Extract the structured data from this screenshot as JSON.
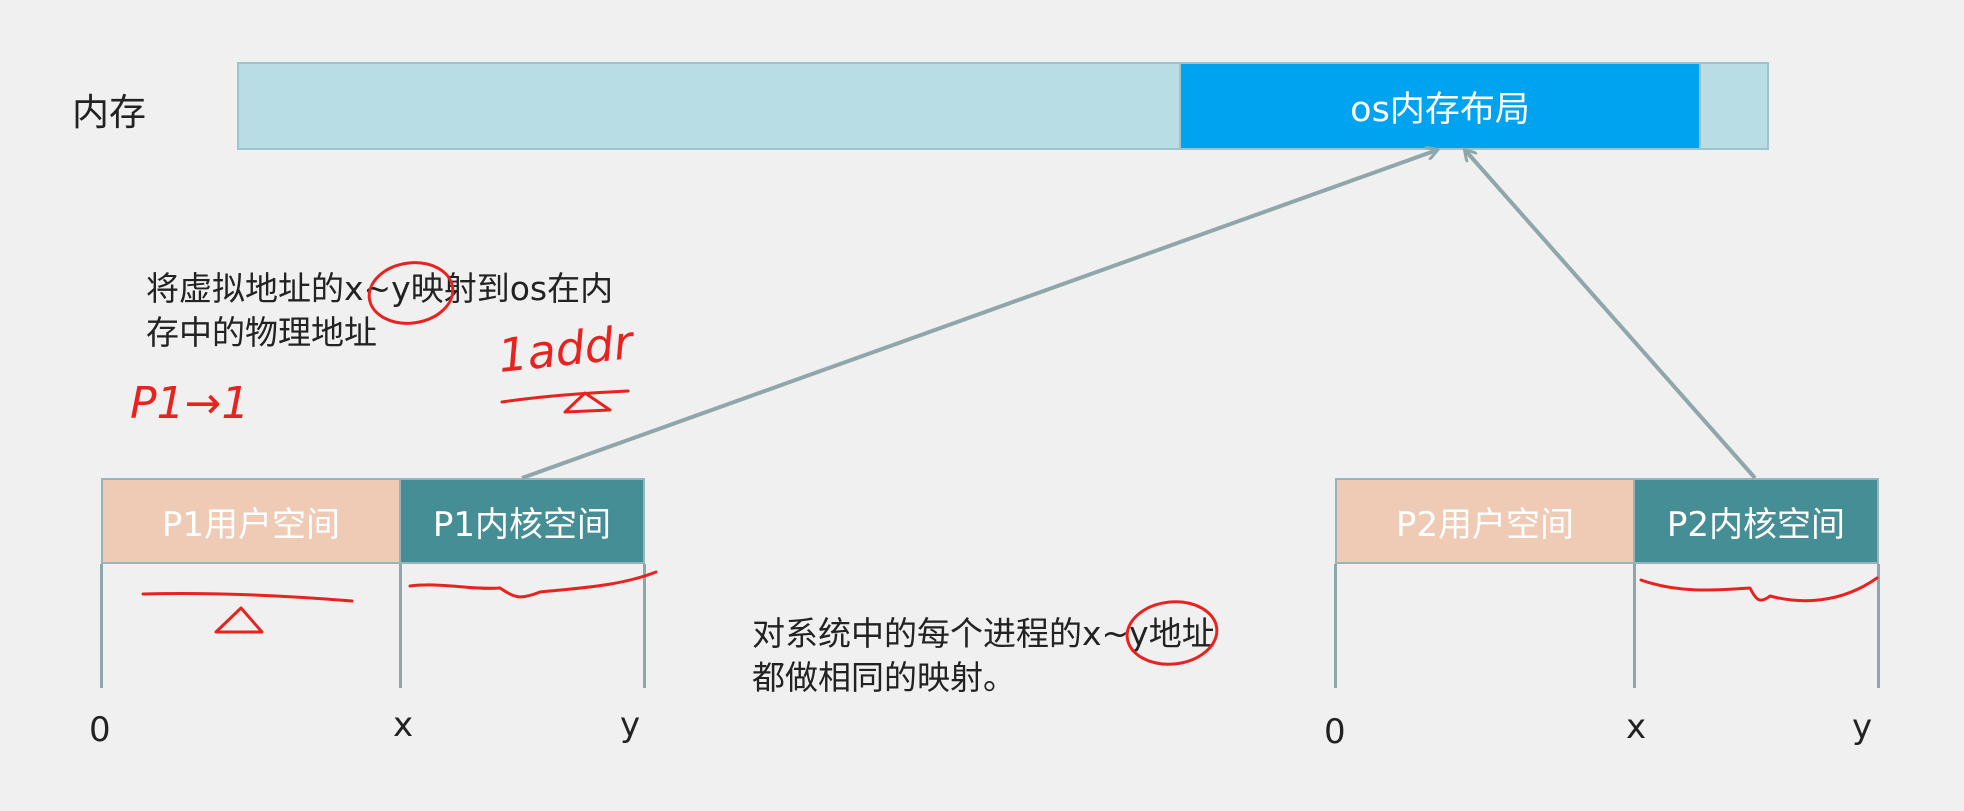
{
  "memory": {
    "label": "内存",
    "os_segment": "os内存布局"
  },
  "p1": {
    "user": "P1用户空间",
    "kernel": "P1内核空间",
    "axis": [
      "0",
      "x",
      "y"
    ]
  },
  "p2": {
    "user": "P2用户空间",
    "kernel": "P2内核空间",
    "axis": [
      "0",
      "x",
      "y"
    ]
  },
  "note_top": [
    "将虚拟地址的x~y映射到os在内",
    "存中的物理地址"
  ],
  "note_bottom": [
    "对系统中的每个进程的x~y地址",
    "都做相同的映射。"
  ],
  "handwriting": [
    "P1→1",
    "1addr"
  ],
  "colors": {
    "memory_bar": "#b9dde4",
    "os_segment": "#00a3f0",
    "user_space": "#efcbb6",
    "kernel_space": "#458e96",
    "arrow": "#8fa6aa",
    "annotation": "#e8231f"
  }
}
